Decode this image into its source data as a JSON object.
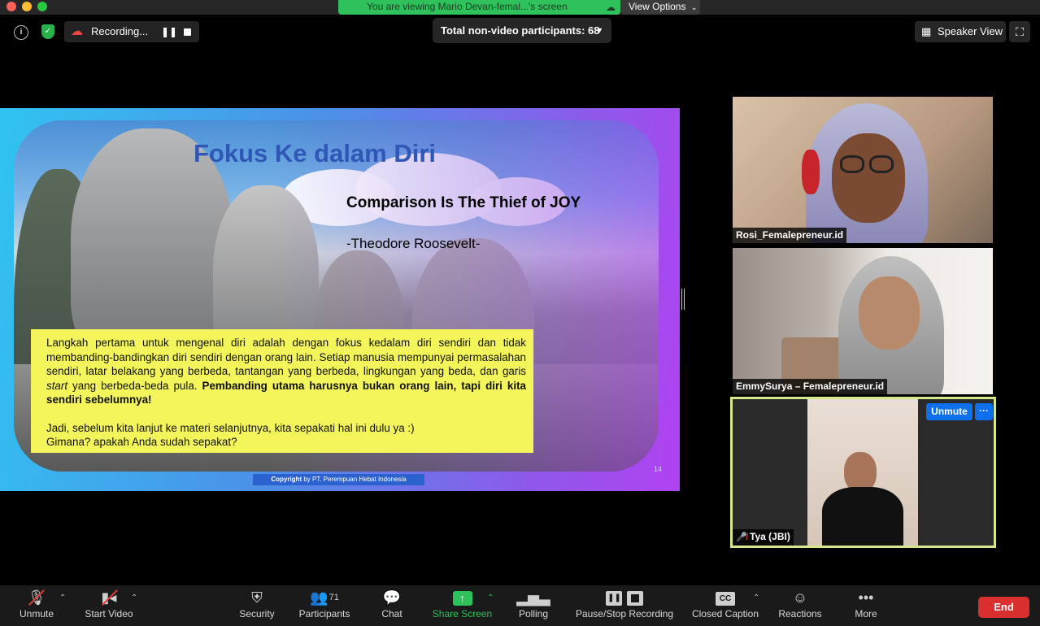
{
  "banner": {
    "text": "You are viewing Mario Devan-femal...'s screen",
    "view_options": "View Options"
  },
  "top": {
    "recording_label": "Recording...",
    "participants_count_label": "Total non-video participants: 68",
    "speaker_view_label": "Speaker View"
  },
  "slide": {
    "title": "Fokus Ke dalam Diri",
    "quote": "Comparison Is The Thief of JOY",
    "author": "-Theodore Roosevelt-",
    "para1_a": "Langkah pertama untuk mengenal diri adalah dengan fokus kedalam diri sendiri dan tidak membanding-bandingkan diri sendiri dengan orang lain. Setiap manusia mempunyai permasalahan sendiri, latar belakang yang berbeda, tantangan yang berbeda, lingkungan yang beda, dan garis ",
    "para1_italic": "start",
    "para1_b": " yang berbeda-beda pula. ",
    "para1_bold": "Pembanding utama harusnya bukan orang lain, tapi diri kita sendiri sebelumnya!",
    "para2_line1": "Jadi, sebelum kita lanjut ke materi selanjutnya, kita sepakati hal ini dulu ya :)",
    "para2_line2": "Gimana? apakah Anda sudah sepakat?",
    "copyright_bold": "Copyright",
    "copyright_rest": " by PT. Perempuan Hebat Indonesia",
    "page_number": "14"
  },
  "videos": [
    {
      "name": "Rosi_Femalepreneur.id"
    },
    {
      "name": "EmmySurya – Femalepreneur.id"
    },
    {
      "name": "Tya (JBI)",
      "unmute_label": "Unmute",
      "more_label": "···"
    }
  ],
  "toolbar": {
    "unmute": "Unmute",
    "start_video": "Start Video",
    "security": "Security",
    "participants": "Participants",
    "participants_count": "71",
    "chat": "Chat",
    "share_screen": "Share Screen",
    "polling": "Polling",
    "pause_stop_recording": "Pause/Stop Recording",
    "closed_caption": "Closed Caption",
    "reactions": "Reactions",
    "more": "More",
    "end": "End"
  },
  "colors": {
    "share_green": "#2ec15c",
    "end_red": "#d92f2f",
    "active_speaker_border": "#d5e88a",
    "unmute_blue": "#0e71eb"
  }
}
